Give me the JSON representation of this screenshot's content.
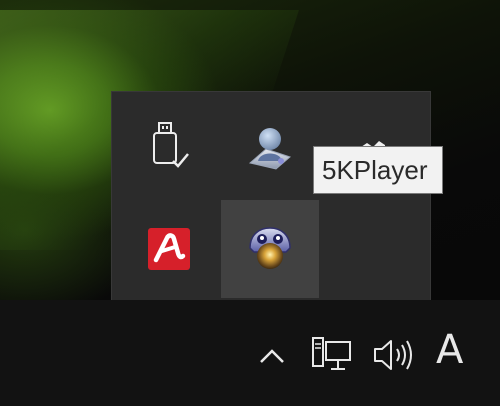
{
  "tooltip": {
    "text": "5KPlayer"
  },
  "tray_flyout": {
    "icons": [
      "usb-safely-remove-icon",
      "network-user-app-icon",
      "onedrive-cloud-icon",
      "avira-antivirus-icon",
      "5kplayer-icon"
    ],
    "hovered_icon": "5kplayer-icon"
  },
  "taskbar": {
    "icons": [
      "chevron-up-icon",
      "network-icon",
      "volume-icon"
    ],
    "input_language": "A"
  },
  "colors": {
    "flyout_bg": "#2b2b2b",
    "hover_bg": "#414141",
    "taskbar_bg": "#121212",
    "avira_red": "#d6202a"
  }
}
